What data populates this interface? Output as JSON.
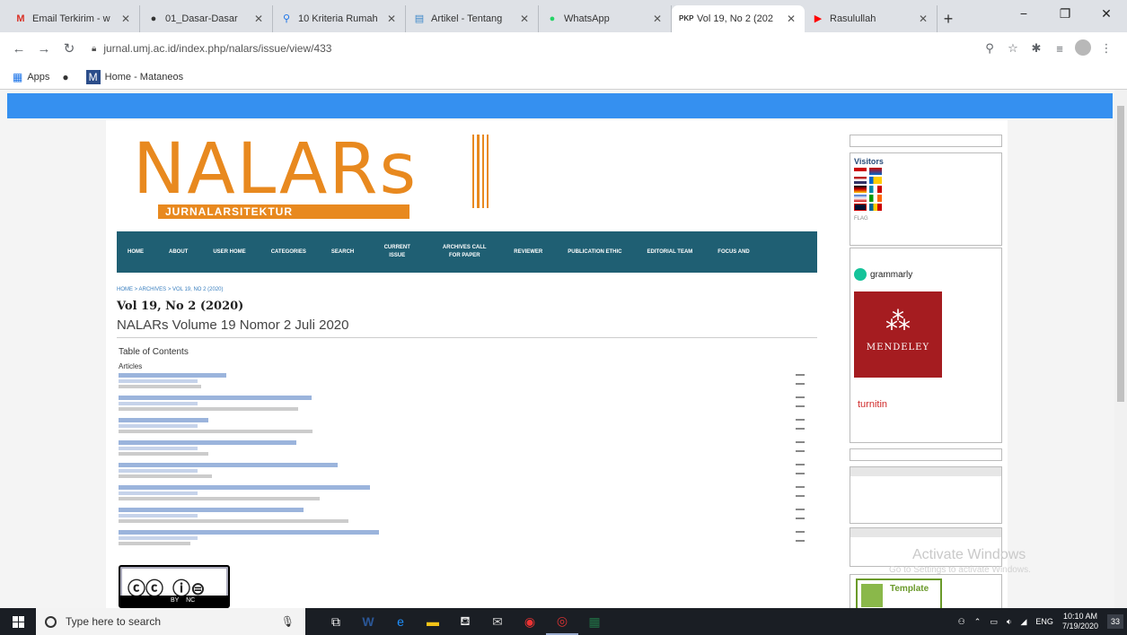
{
  "browser": {
    "tabs": [
      {
        "label": "Email Terkirim - w",
        "icon": "gmail-icon",
        "active": false
      },
      {
        "label": "01_Dasar-Dasar",
        "icon": "github-icon",
        "active": false
      },
      {
        "label": "10 Kriteria Rumah",
        "icon": "maps-pin-icon",
        "active": false
      },
      {
        "label": "Artikel - Tentang",
        "icon": "doc-icon",
        "active": false
      },
      {
        "label": "WhatsApp",
        "icon": "whatsapp-icon",
        "active": false
      },
      {
        "label": "Vol 19, No 2 (202",
        "icon": "pkp-icon",
        "active": true
      },
      {
        "label": "Rasulullah",
        "icon": "youtube-icon",
        "active": false
      }
    ],
    "url": "jurnal.umj.ac.id/index.php/nalars/issue/view/433",
    "bookmarks": [
      {
        "label": "Apps",
        "icon": "apps-grid-icon"
      },
      {
        "label": "",
        "icon": "github-icon"
      },
      {
        "label": "Home - Mataneos",
        "icon": "m-logo-icon"
      }
    ]
  },
  "page": {
    "logo_text": "NALARs",
    "logo_sub": "JURNALARSITEKTUR",
    "nav": [
      "HOME",
      "ABOUT",
      "USER HOME",
      "CATEGORIES",
      "SEARCH",
      "CURRENT ISSUE",
      "ARCHIVES CALL FOR PAPER",
      "REVIEWER",
      "PUBLICATION ETHIC",
      "EDITORIAL TEAM",
      "FOCUS AND"
    ],
    "breadcrumb": "HOME > ARCHIVES > VOL 19, NO 2 (2020)",
    "issue_title": "Vol 19, No 2 (2020)",
    "issue_subtitle": "NALARs Volume 19 Nomor 2 Juli 2020",
    "toc_heading": "Table of Contents",
    "section": "Articles"
  },
  "sidebar": {
    "visitors_title": "Visitors",
    "flag_label": "FLAG",
    "grammarly": "grammarly",
    "mendeley": "MENDELEY",
    "turnitin": "turnitin",
    "template": "Template"
  },
  "watermark": {
    "title": "Activate Windows",
    "sub": "Go to Settings to activate Windows."
  },
  "taskbar": {
    "search_placeholder": "Type here to search",
    "time": "10:10 AM",
    "date": "7/19/2020",
    "lang": "ENG",
    "notif_count": "33"
  }
}
